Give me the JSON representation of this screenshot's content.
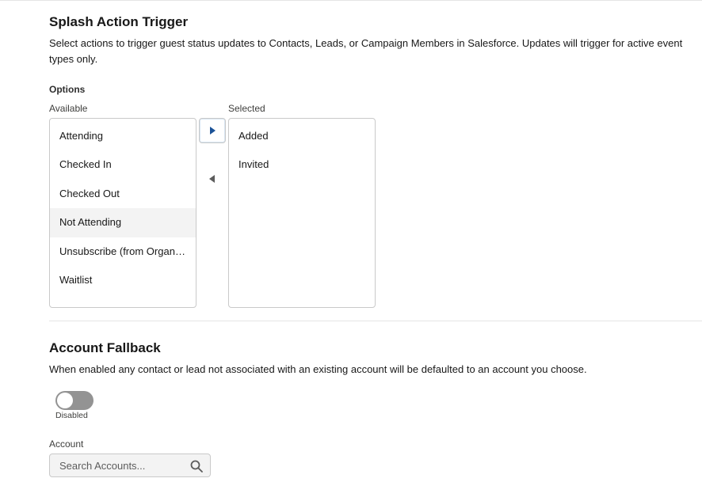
{
  "splash_trigger": {
    "title": "Splash Action Trigger",
    "description": "Select actions to trigger guest status updates to Contacts, Leads, or Campaign Members in Salesforce. Updates will trigger for active event types only.",
    "options_label": "Options",
    "available_label": "Available",
    "selected_label": "Selected",
    "available_items": [
      {
        "label": "Attending"
      },
      {
        "label": "Checked In"
      },
      {
        "label": "Checked Out"
      },
      {
        "label": "Not Attending"
      },
      {
        "label": "Unsubscribe (from Organization)"
      },
      {
        "label": "Waitlist"
      }
    ],
    "highlighted_item": "Not Attending",
    "selected_items": [
      {
        "label": "Added"
      },
      {
        "label": "Invited"
      }
    ],
    "move_right_icon": "triangle-right-icon",
    "move_left_icon": "triangle-left-icon"
  },
  "account_fallback": {
    "title": "Account Fallback",
    "description": "When enabled any contact or lead not associated with an existing account will be defaulted to an account you choose.",
    "toggle_state": "Disabled",
    "toggle_on": false,
    "account_label": "Account",
    "search_placeholder": "Search Accounts...",
    "search_icon": "search-icon"
  },
  "colors": {
    "toggle_off": "#939393",
    "highlight_row": "#f3f3f3",
    "border": "#c9c9c9",
    "arrow": "#1b5297"
  }
}
